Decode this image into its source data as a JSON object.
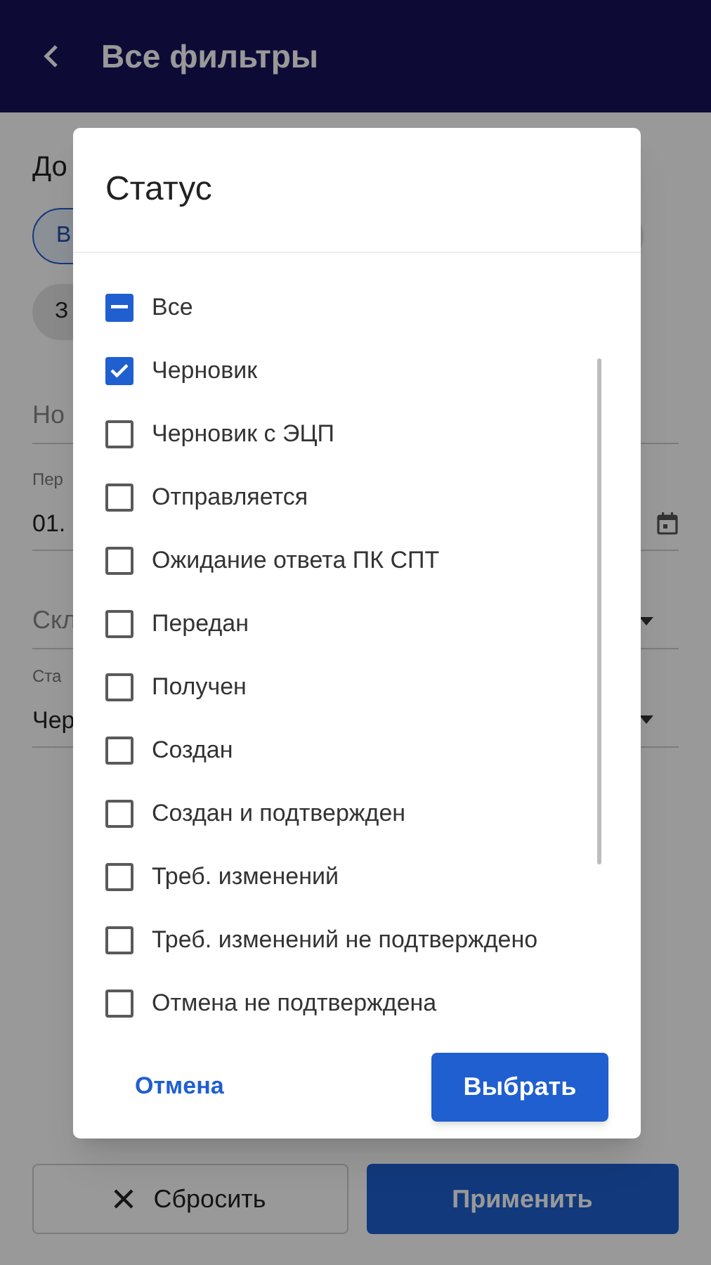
{
  "header": {
    "title": "Все фильтры"
  },
  "filters": {
    "section_title": "До",
    "chip_rows": [
      [
        {
          "label": "В",
          "selected": true
        },
        {
          "selected": false
        }
      ],
      [
        {
          "label": "З",
          "selected": false
        }
      ]
    ],
    "fields": [
      {
        "kind": "text",
        "placeholder": "Но"
      },
      {
        "kind": "date",
        "label": "Пер",
        "value": "01."
      },
      {
        "kind": "select",
        "placeholder": "Скл"
      },
      {
        "kind": "select",
        "label": "Ста",
        "value": "Чер"
      }
    ]
  },
  "footer": {
    "reset": "Сбросить",
    "apply": "Применить"
  },
  "dialog": {
    "title": "Статус",
    "select_all": {
      "label": "Все",
      "indeterminate": true
    },
    "options": [
      {
        "label": "Черновик",
        "checked": true
      },
      {
        "label": "Черновик с ЭЦП",
        "checked": false
      },
      {
        "label": "Отправляется",
        "checked": false
      },
      {
        "label": "Ожидание ответа ПК СПТ",
        "checked": false
      },
      {
        "label": "Передан",
        "checked": false
      },
      {
        "label": "Получен",
        "checked": false
      },
      {
        "label": "Создан",
        "checked": false
      },
      {
        "label": "Создан и подтвержден",
        "checked": false
      },
      {
        "label": "Треб. изменений",
        "checked": false
      },
      {
        "label": "Треб. изменений не подтверждено",
        "checked": false
      },
      {
        "label": "Отмена не подтверждена",
        "checked": false
      }
    ],
    "cancel": "Отмена",
    "confirm": "Выбрать"
  }
}
